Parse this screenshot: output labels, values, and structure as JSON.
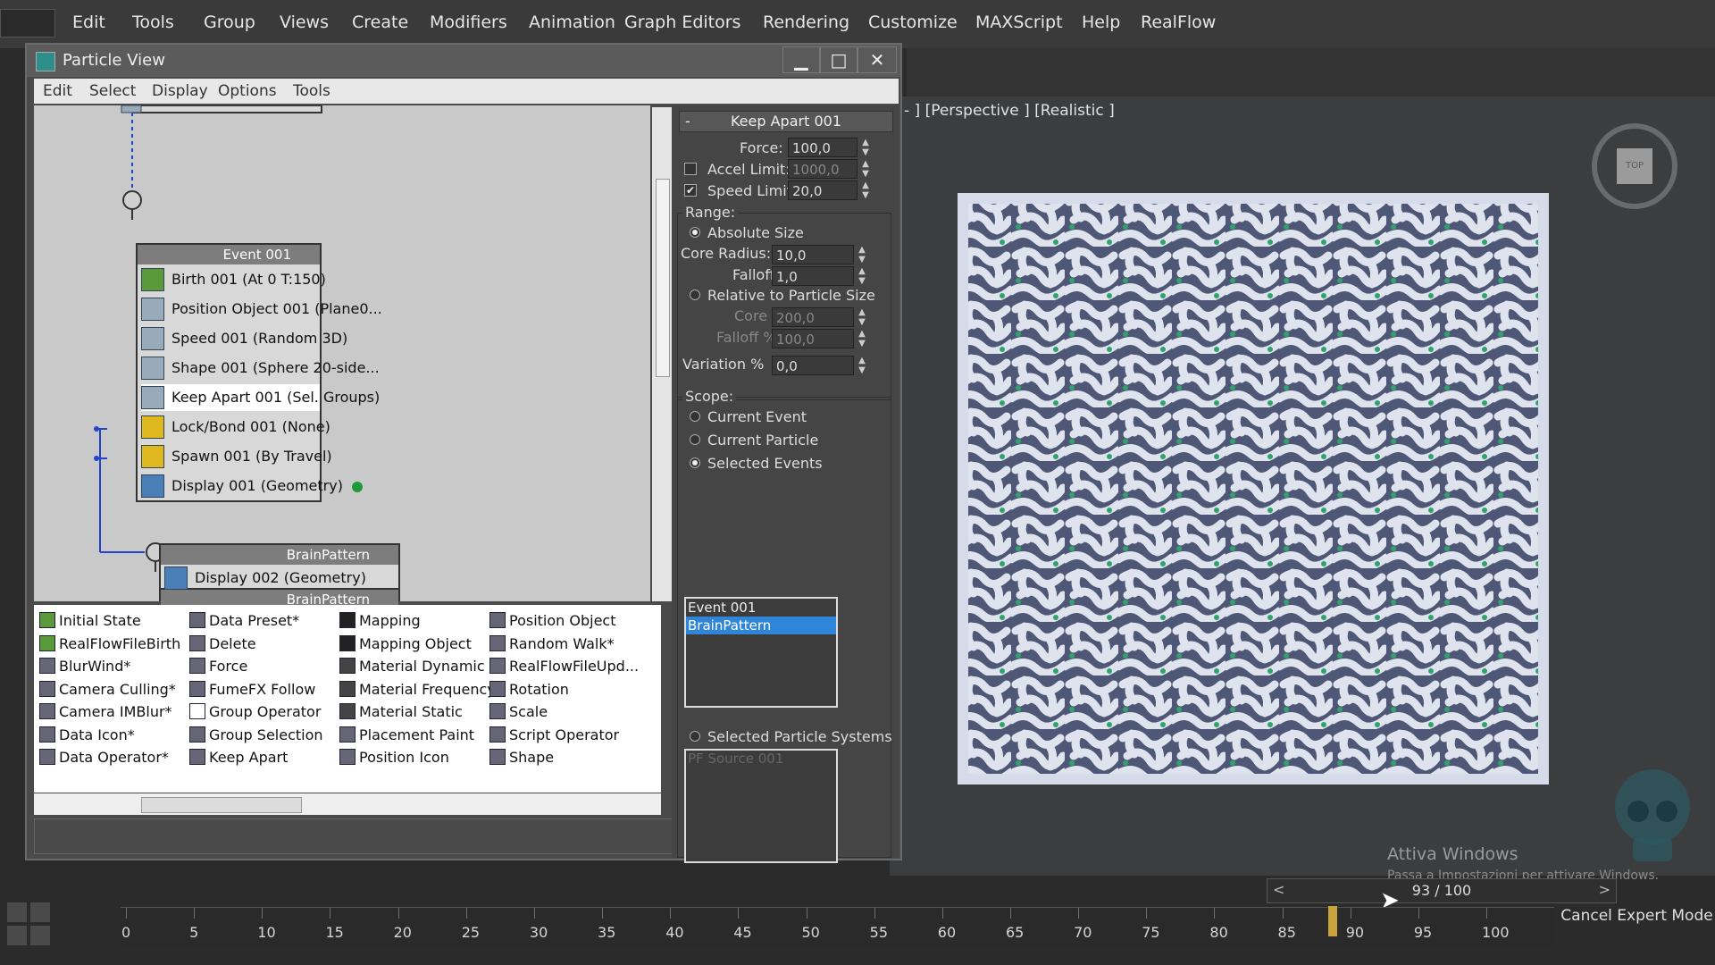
{
  "main_menu": {
    "items": [
      "Edit",
      "Tools",
      "Group",
      "Views",
      "Create",
      "Modifiers",
      "Animation",
      "Graph Editors",
      "Rendering",
      "Customize",
      "MAXScript",
      "Help",
      "RealFlow"
    ]
  },
  "particle_view": {
    "title": "Particle View",
    "window_buttons": {
      "minimize": "▁",
      "maximize": "□",
      "close": "✕"
    },
    "menu": [
      "Edit",
      "Select",
      "Display",
      "Options",
      "Tools"
    ],
    "event1": {
      "name": "Event 001",
      "operators": [
        {
          "label": "Birth 001 (At 0 T:150)",
          "icon": "birth-icon"
        },
        {
          "label": "Position Object 001 (Plane0...",
          "icon": "position-object-icon"
        },
        {
          "label": "Speed 001 (Random 3D)",
          "icon": "speed-icon"
        },
        {
          "label": "Shape 001 (Sphere 20-side...",
          "icon": "shape-icon"
        },
        {
          "label": "Keep Apart 001 (Sel. Groups)",
          "icon": "keep-apart-icon"
        },
        {
          "label": "Lock/Bond 001 (None)",
          "icon": "lock-bond-icon"
        },
        {
          "label": "Spawn 001 (By Travel)",
          "icon": "spawn-icon"
        },
        {
          "label": "Display 001 (Geometry)",
          "icon": "display-icon"
        }
      ]
    },
    "event2": {
      "name": "BrainPattern",
      "operators": [
        {
          "label": "Display 002 (Geometry)",
          "icon": "display-icon"
        }
      ]
    },
    "depot": {
      "col1": [
        "Initial State",
        "RealFlowFileBirth",
        "BlurWind*",
        "Camera Culling*",
        "Camera IMBlur*",
        "Data Icon*",
        "Data Operator*"
      ],
      "col2": [
        "Data Preset*",
        "Delete",
        "Force",
        "FumeFX Follow",
        "Group Operator",
        "Group Selection",
        "Keep Apart"
      ],
      "col3": [
        "Mapping",
        "Mapping Object",
        "Material Dynamic",
        "Material Frequency",
        "Material Static",
        "Placement Paint",
        "Position Icon"
      ],
      "col4": [
        "Position Object",
        "Random Walk*",
        "RealFlowFileUpd...",
        "Rotation",
        "Scale",
        "Script Operator",
        "Shape"
      ]
    },
    "params": {
      "rollout_title": "Keep Apart 001",
      "rollout_toggle": "-",
      "force_label": "Force:",
      "force_value": "100,0",
      "accel_label": "Accel Limit:",
      "accel_value": "1000,0",
      "accel_checked": false,
      "speed_label": "Speed Limit:",
      "speed_value": "20,0",
      "speed_checked": true,
      "range_label": "Range:",
      "absolute_size": "Absolute Size",
      "core_radius_label": "Core Radius:",
      "core_radius_value": "10,0",
      "falloff_label": "Falloff",
      "falloff_value": "1,0",
      "relative_size": "Relative to Particle Size",
      "core_pct_label": "Core %",
      "core_pct_value": "200,0",
      "falloff_pct_label": "Falloff %",
      "falloff_pct_value": "100,0",
      "variation_label": "Variation %",
      "variation_value": "0,0",
      "scope_label": "Scope:",
      "current_event": "Current Event",
      "current_particle": "Current Particle",
      "selected_events": "Selected Events",
      "event_list": [
        "Event 001",
        "BrainPattern"
      ],
      "selected_event": "BrainPattern",
      "selected_particle_systems": "Selected Particle Systems",
      "ps_list": [
        "PF Source 001"
      ]
    }
  },
  "viewport": {
    "label": "- ] [Perspective ] [Realistic ]",
    "viewcube_face": "TOP",
    "watermark_title": "Attiva Windows",
    "watermark_sub": "Passa a Impostazioni per attivare Windows."
  },
  "timeline": {
    "current_frame": "93 / 100",
    "prev": "<",
    "next": ">",
    "ticks": [
      "0",
      "5",
      "10",
      "15",
      "20",
      "25",
      "30",
      "35",
      "40",
      "45",
      "50",
      "55",
      "60",
      "65",
      "70",
      "75",
      "80",
      "85",
      "90",
      "95",
      "100"
    ],
    "cancel_expert": "Cancel Expert Mode"
  },
  "colors": {
    "selection_blue": "#2f86d8",
    "render_base": "#d5dbe8",
    "render_green": "#2fa36b",
    "frame_marker": "#c8a23c"
  }
}
